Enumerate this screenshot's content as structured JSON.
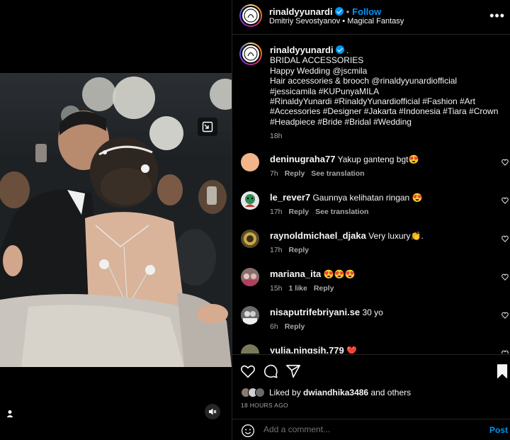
{
  "post": {
    "username": "rinaldyyunardi",
    "follow_label": "Follow",
    "dot": "•",
    "audio": "Dmitriy Sevostyanov • Magical Fantasy",
    "more_icon": "more-horizontal-icon"
  },
  "caption": {
    "username": "rinaldyyunardi",
    "suffix": ".",
    "lines": [
      "BRIDAL ACCESSORIES",
      "Happy Wedding @jscmila",
      "Hair accessories & brooch @rinaldyyunardiofficial",
      "#jessicamila #KUPunyaMILA",
      "#RinaldyYunardi #RinaldyYunardiofficial #Fashion #Art",
      "#Accessories #Designer #Jakarta #Indonesia #Tiara #Crown",
      "#Headpiece #Bride #Bridal #Wedding"
    ],
    "time": "18h"
  },
  "comments": [
    {
      "user": "deninugraha77",
      "text": "Yakup ganteng bgt😍",
      "time": "7h",
      "likes": "",
      "reply": "Reply",
      "translate": "See translation",
      "avatar_color": "#f2b48a"
    },
    {
      "user": "le_rever7",
      "text": "Gaunnya kelihatan ringan 😍",
      "time": "17h",
      "likes": "",
      "reply": "Reply",
      "translate": "See translation",
      "avatar_color": "#e6e6e6"
    },
    {
      "user": "raynoldmichael_djaka",
      "text": "Very luxury👏.",
      "time": "17h",
      "likes": "",
      "reply": "Reply",
      "translate": "",
      "avatar_color": "#5a4a2a"
    },
    {
      "user": "mariana_ita",
      "text": "😍😍😍",
      "time": "15h",
      "likes": "1 like",
      "reply": "Reply",
      "translate": "",
      "avatar_color": "#8a6d6d"
    },
    {
      "user": "nisaputrifebriyani.se",
      "text": "30 yo",
      "time": "6h",
      "likes": "",
      "reply": "Reply",
      "translate": "",
      "avatar_color": "#6b6b6b"
    },
    {
      "user": "yulia.ningsih.779",
      "text": "❤️",
      "time": "",
      "likes": "",
      "reply": "",
      "translate": "",
      "avatar_color": "#7a7a5a"
    }
  ],
  "actions": {
    "liked_by_prefix": "Liked by",
    "liked_by_user": "dwiandhika3486",
    "liked_by_suffix": "and others",
    "time_ago": "18 HOURS AGO"
  },
  "add_comment": {
    "placeholder": "Add a comment...",
    "post_label": "Post"
  },
  "colors": {
    "accent": "#0095f6",
    "background": "#000000",
    "divider": "#262626",
    "secondary_text": "#a8a8a8"
  }
}
